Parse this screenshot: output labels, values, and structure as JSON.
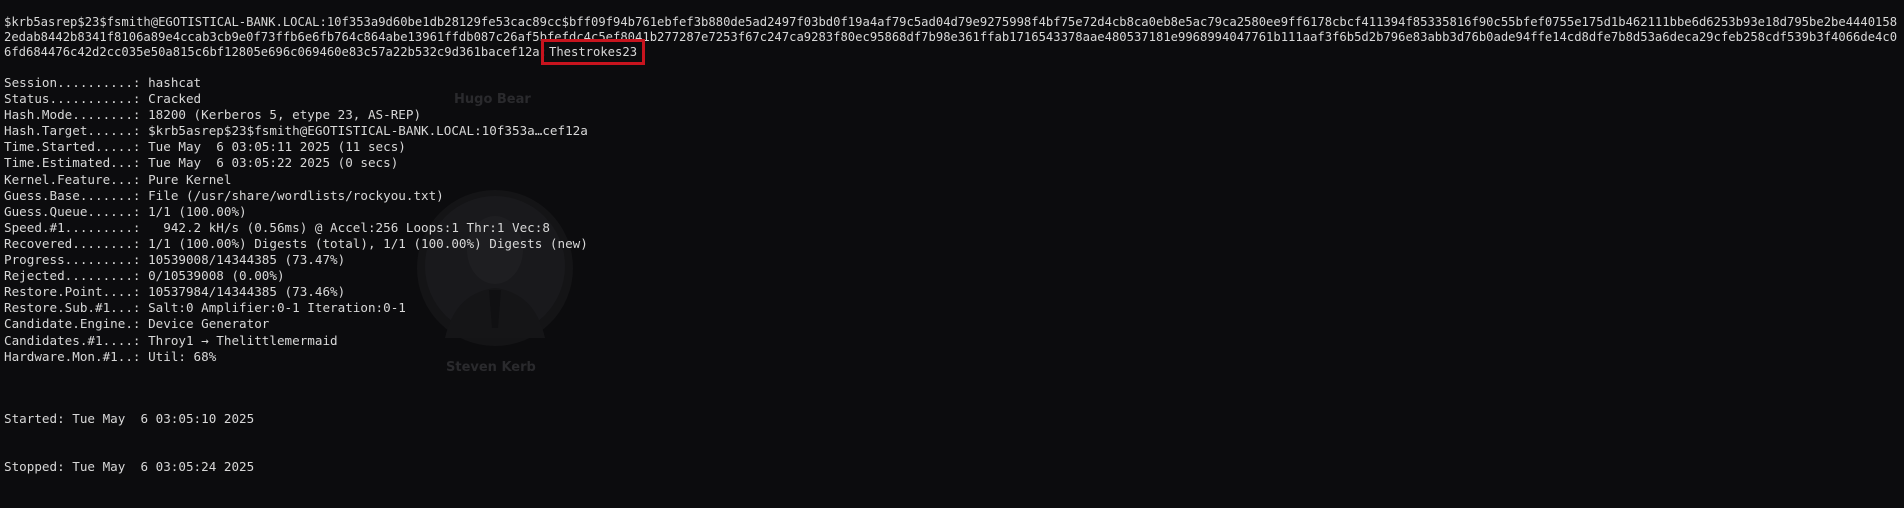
{
  "terminal": {
    "hash_text": "$krb5asrep$23$fsmith@EGOTISTICAL-BANK.LOCAL:10f353a9d60be1db28129fe53cac89cc$bff09f94b761ebfef3b880de5ad2497f03bd0f19a4af79c5ad04d79e9275998f4bf75e72d4cb8ca0eb8e5ac79ca2580ee9ff6178cbcf411394f85335816f90c55bfef0755e175d1b462111bbe6d6253b93e18d795be2be44401582edab8442b8341f8106a89e4ccab3cb9e0f73ffb6e6fb764c864abe13961ffdb087c26af5bfefdc4c5ef8041b277287e7253f67c247ca9283f80ec95868df7b98e361ffab1716543378aae480537181e9968994047761b111aaf3f6b5d2b796e83abb3d76b0ade94ffe14cd8dfe7b8d53a6deca29cfeb258cdf539b3f4066de4c06fd684476c42d2cc035e50a815c6bf12805e696c069460e83c57a22b532c9d361bacef12a:",
    "cracked_password": "Thestrokes23",
    "status_rows": [
      {
        "key": "Session..........:",
        "value": " hashcat"
      },
      {
        "key": "Status...........:",
        "value": " Cracked"
      },
      {
        "key": "Hash.Mode........:",
        "value": " 18200 (Kerberos 5, etype 23, AS-REP)"
      },
      {
        "key": "Hash.Target......:",
        "value": " $krb5asrep$23$fsmith@EGOTISTICAL-BANK.LOCAL:10f353a…cef12a"
      },
      {
        "key": "Time.Started.....:",
        "value": " Tue May  6 03:05:11 2025 (11 secs)"
      },
      {
        "key": "Time.Estimated...:",
        "value": " Tue May  6 03:05:22 2025 (0 secs)"
      },
      {
        "key": "Kernel.Feature...:",
        "value": " Pure Kernel"
      },
      {
        "key": "Guess.Base.......:",
        "value": " File (/usr/share/wordlists/rockyou.txt)"
      },
      {
        "key": "Guess.Queue......:",
        "value": " 1/1 (100.00%)"
      },
      {
        "key": "Speed.#1.........:",
        "value": "   942.2 kH/s (0.56ms) @ Accel:256 Loops:1 Thr:1 Vec:8"
      },
      {
        "key": "Recovered........:",
        "value": " 1/1 (100.00%) Digests (total), 1/1 (100.00%) Digests (new)"
      },
      {
        "key": "Progress.........:",
        "value": " 10539008/14344385 (73.47%)"
      },
      {
        "key": "Rejected.........:",
        "value": " 0/10539008 (0.00%)"
      },
      {
        "key": "Restore.Point....:",
        "value": " 10537984/14344385 (73.46%)"
      },
      {
        "key": "Restore.Sub.#1...:",
        "value": " Salt:0 Amplifier:0-1 Iteration:0-1"
      },
      {
        "key": "Candidate.Engine.:",
        "value": " Device Generator"
      },
      {
        "key": "Candidates.#1....:",
        "value": " Throy1 → Thelittlemermaid"
      },
      {
        "key": "Hardware.Mon.#1..:",
        "value": " Util: 68%"
      }
    ],
    "started": "Started: Tue May  6 03:05:10 2025",
    "stopped": "Stopped: Tue May  6 03:05:24 2025"
  },
  "watermark": {
    "name_top": "Hugo Bear",
    "name_bottom": "Steven Kerb"
  },
  "colors": {
    "background": "#0c0c0e",
    "text": "#d8d8d8",
    "highlight_border": "#c8141e"
  }
}
